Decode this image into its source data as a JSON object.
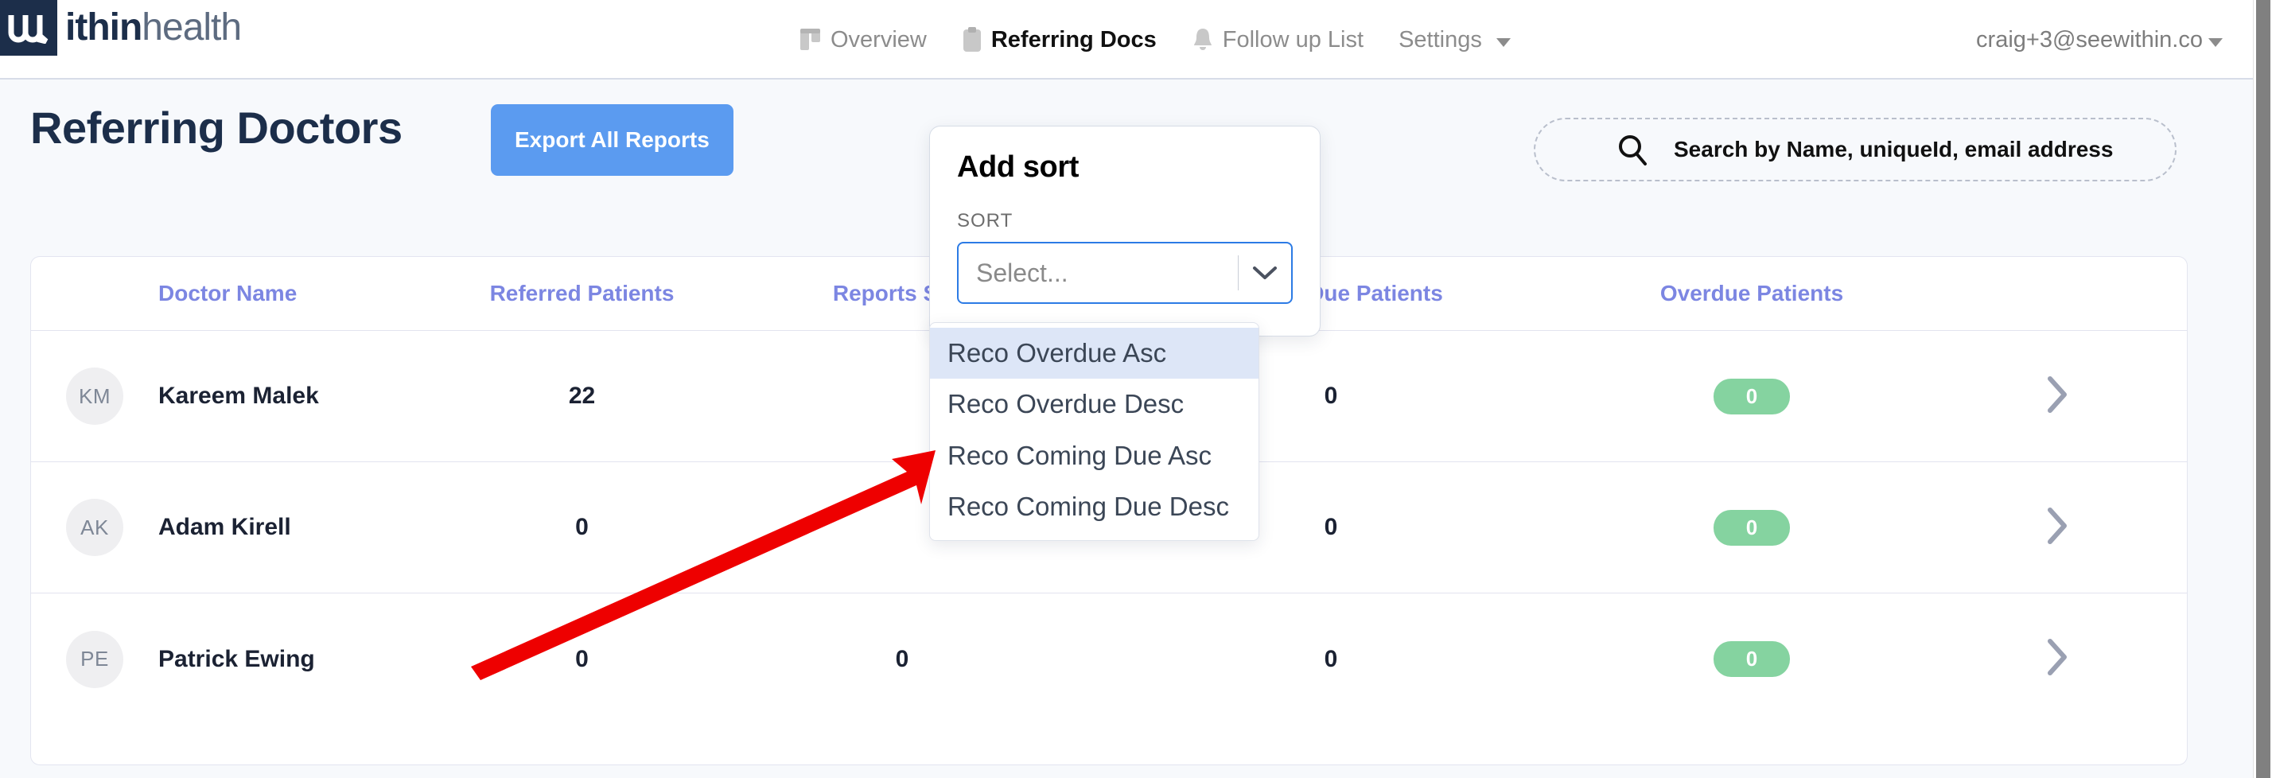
{
  "brand": {
    "logo_mark_letter": "w",
    "logo_text_bold": "ithin",
    "logo_text_light": "health",
    "colors": {
      "navy": "#1C2E4A",
      "accent_blue": "#5B9BF0",
      "header_purple": "#7C86E2",
      "pill_green": "#85D3A0",
      "focus_blue": "#2C7BE5",
      "option_highlight": "#DDE6F7",
      "page_bg": "#F7F9FC"
    }
  },
  "topnav": {
    "items": [
      {
        "label": "Overview",
        "icon": "columns-icon",
        "active": false
      },
      {
        "label": "Referring Docs",
        "icon": "clipboard-icon",
        "active": true
      },
      {
        "label": "Follow up List",
        "icon": "bell-icon",
        "active": false
      },
      {
        "label": "Settings",
        "icon": "chevron-down-icon",
        "active": false
      }
    ],
    "user_email": "craig+3@seewithin.co"
  },
  "page": {
    "title": "Referring Doctors",
    "export_button": "Export All Reports"
  },
  "search": {
    "placeholder": "Search by Name, uniqueId, email address",
    "value": "",
    "icon": "search-icon"
  },
  "table": {
    "columns": [
      "Doctor Name",
      "Referred Patients",
      "Reports Sent",
      "Coming Due Patients",
      "Overdue Patients"
    ],
    "rows": [
      {
        "initials": "KM",
        "name": "Kareem Malek",
        "referred_patients": "22",
        "reports_sent": "",
        "coming_due_patients": "0",
        "overdue_patients": "0"
      },
      {
        "initials": "AK",
        "name": "Adam Kirell",
        "referred_patients": "0",
        "reports_sent": "",
        "coming_due_patients": "0",
        "overdue_patients": "0"
      },
      {
        "initials": "PE",
        "name": "Patrick Ewing",
        "referred_patients": "0",
        "reports_sent": "0",
        "coming_due_patients": "0",
        "overdue_patients": "0"
      }
    ],
    "row_chevron_icon": "chevron-right-icon"
  },
  "add_sort_popover": {
    "title": "Add sort",
    "field_label": "SORT",
    "select_value": "",
    "select_placeholder": "Select...",
    "dropdown_icon": "chevron-down-icon",
    "options": [
      {
        "label": "Reco Overdue Asc",
        "highlighted": true
      },
      {
        "label": "Reco Overdue Desc",
        "highlighted": false
      },
      {
        "label": "Reco Coming Due Asc",
        "highlighted": false
      },
      {
        "label": "Reco Coming Due Desc",
        "highlighted": false
      }
    ]
  },
  "annotation": {
    "type": "arrow",
    "color": "#EE0000",
    "points_to": "add-sort-popover"
  }
}
